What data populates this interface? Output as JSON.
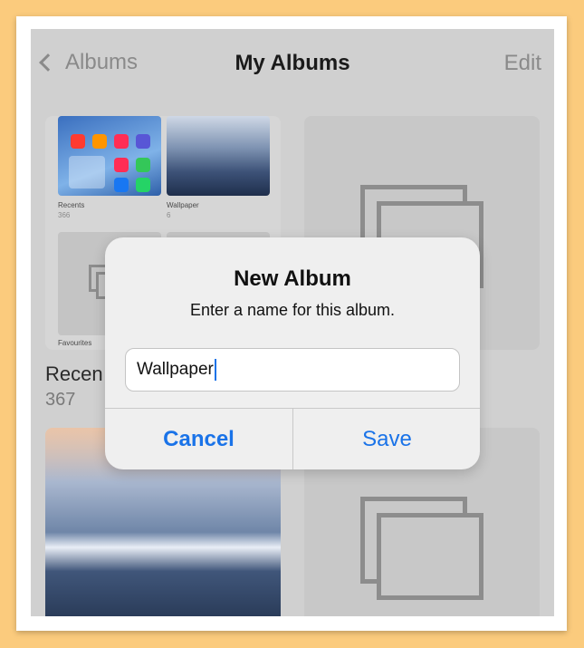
{
  "nav": {
    "back_label": "Albums",
    "title": "My Albums",
    "edit_label": "Edit"
  },
  "albums": [
    {
      "name": "Recen",
      "count": "367",
      "previews": [
        {
          "label": "Recents",
          "count": "366"
        },
        {
          "label": "Wallpaper",
          "count": "6"
        },
        {
          "label": "Favourites",
          "count": ""
        }
      ]
    }
  ],
  "dialog": {
    "title": "New Album",
    "message": "Enter a name for this album.",
    "input_value": "Wallpaper",
    "cancel_label": "Cancel",
    "save_label": "Save"
  },
  "colors": {
    "accent": "#1a73e8",
    "frame_bg": "#fbcb7d",
    "dim_bg": "#d0d0d0"
  }
}
